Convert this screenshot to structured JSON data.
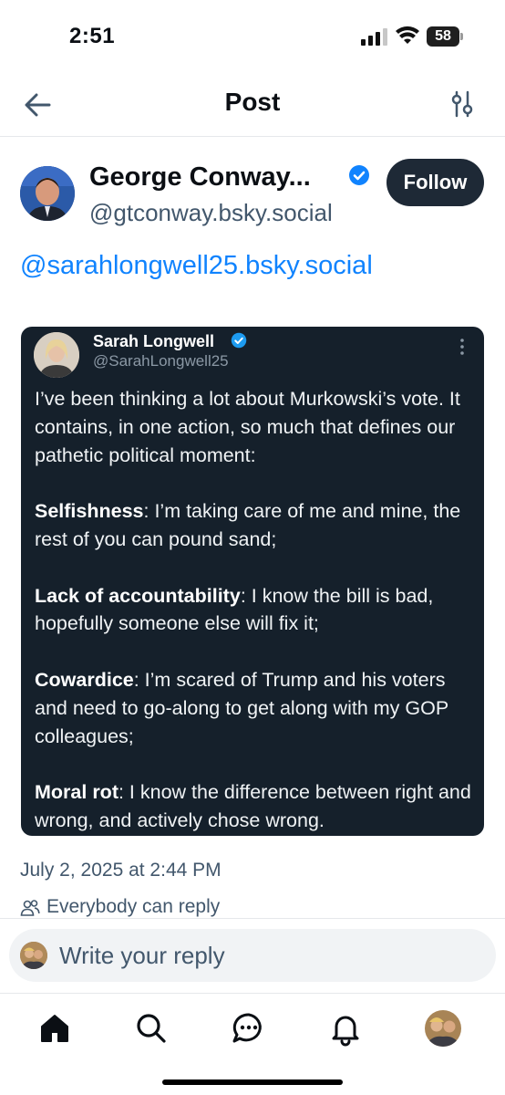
{
  "status_bar": {
    "time": "2:51",
    "battery_level": "58"
  },
  "header": {
    "title": "Post",
    "back_icon": "arrow-left-icon",
    "settings_icon": "sliders-icon"
  },
  "post": {
    "author": {
      "display_name": "George Conway...",
      "handle": "@gtconway.bsky.social",
      "verified": true
    },
    "follow_label": "Follow",
    "text": "@sarahlongwell25.bsky.social",
    "quote": {
      "name": "Sarah Longwell",
      "handle": "@SarahLongwell25",
      "verified": true,
      "paragraphs": [
        {
          "bold": "",
          "text": "I’ve been thinking a lot about Murkowski’s vote. It contains, in one action, so much that defines our pathetic political moment:"
        },
        {
          "bold": "Selfishness",
          "text": ": I’m taking care of me and mine, the rest of you can pound sand;"
        },
        {
          "bold": "Lack of accountability",
          "text": ": I know the bill is bad, hopefully someone else will fix it;"
        },
        {
          "bold": "Cowardice",
          "text": ": I’m scared of Trump and his voters and need to go-along to get along with my GOP colleagues;"
        },
        {
          "bold": "Moral rot",
          "text": ": I know the difference between right and wrong, and actively chose wrong."
        }
      ]
    },
    "timestamp": "July 2, 2025 at 2:44 PM",
    "reply_permission": "Everybody can reply"
  },
  "composer": {
    "placeholder": "Write your reply"
  },
  "tabs": [
    {
      "name": "home",
      "icon": "home-icon",
      "active": true
    },
    {
      "name": "search",
      "icon": "search-icon",
      "active": false
    },
    {
      "name": "chat",
      "icon": "chat-icon",
      "active": false
    },
    {
      "name": "notifications",
      "icon": "bell-icon",
      "active": false
    },
    {
      "name": "profile",
      "icon": "avatar",
      "active": false
    }
  ],
  "colors": {
    "accent": "#1083fe",
    "follow_bg": "#1e2936",
    "quote_bg": "#15202b",
    "muted_text": "#42576c"
  }
}
